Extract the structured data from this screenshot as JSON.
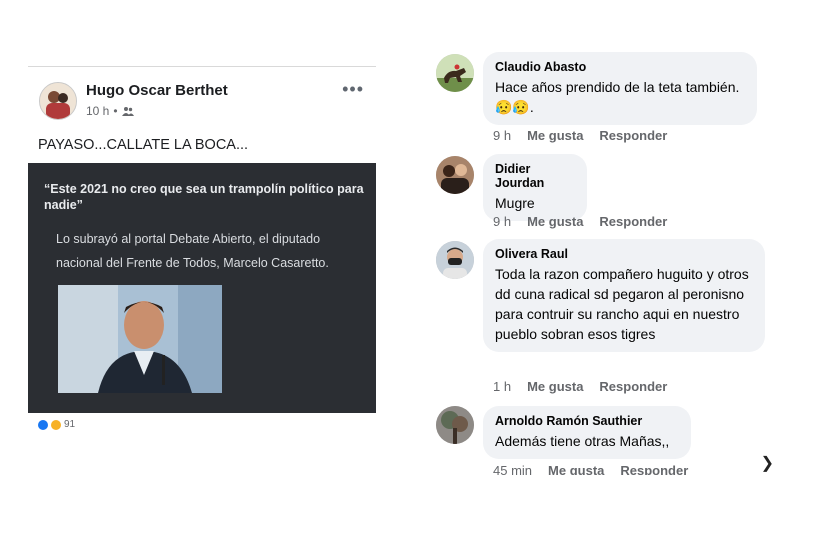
{
  "post": {
    "author": "Hugo Oscar Berthet",
    "time": "10 h",
    "separator": "•",
    "more": "•••",
    "text": "PAYASO...CALLATE LA BOCA...",
    "card": {
      "quote": "“Este 2021 no creo que sea un trampolín político para nadie”",
      "lead": "Lo subrayó al portal Debate Abierto, el diputado nacional del Frente de Todos, Marcelo Casaretto."
    },
    "reaction_count": "91"
  },
  "comments": [
    {
      "name": "Claudio Abasto",
      "text": "Hace años prendido de la teta también.😥😥.",
      "time": "9 h",
      "like": "Me gusta",
      "reply": "Responder"
    },
    {
      "name": "Didier Jourdan",
      "text": "Mugre",
      "time": "9 h",
      "like": "Me gusta",
      "reply": "Responder"
    },
    {
      "name": "Olivera Raul",
      "text": "Toda la razon compañero huguito y otros dd cuna radical sd pegaron al peronisno para contruir su rancho aqui en nuestro pueblo sobran esos tigres",
      "time": "1 h",
      "like": "Me gusta",
      "reply": "Responder"
    },
    {
      "name": "Arnoldo Ramón Sauthier",
      "text": "Además tiene otras Mañas,,",
      "time": "45 min",
      "like": "Me gusta",
      "reply": "Responder"
    }
  ],
  "colors": {
    "bubble": "#f0f2f5",
    "card_bg": "#2b2e33",
    "muted": "#65676b"
  }
}
